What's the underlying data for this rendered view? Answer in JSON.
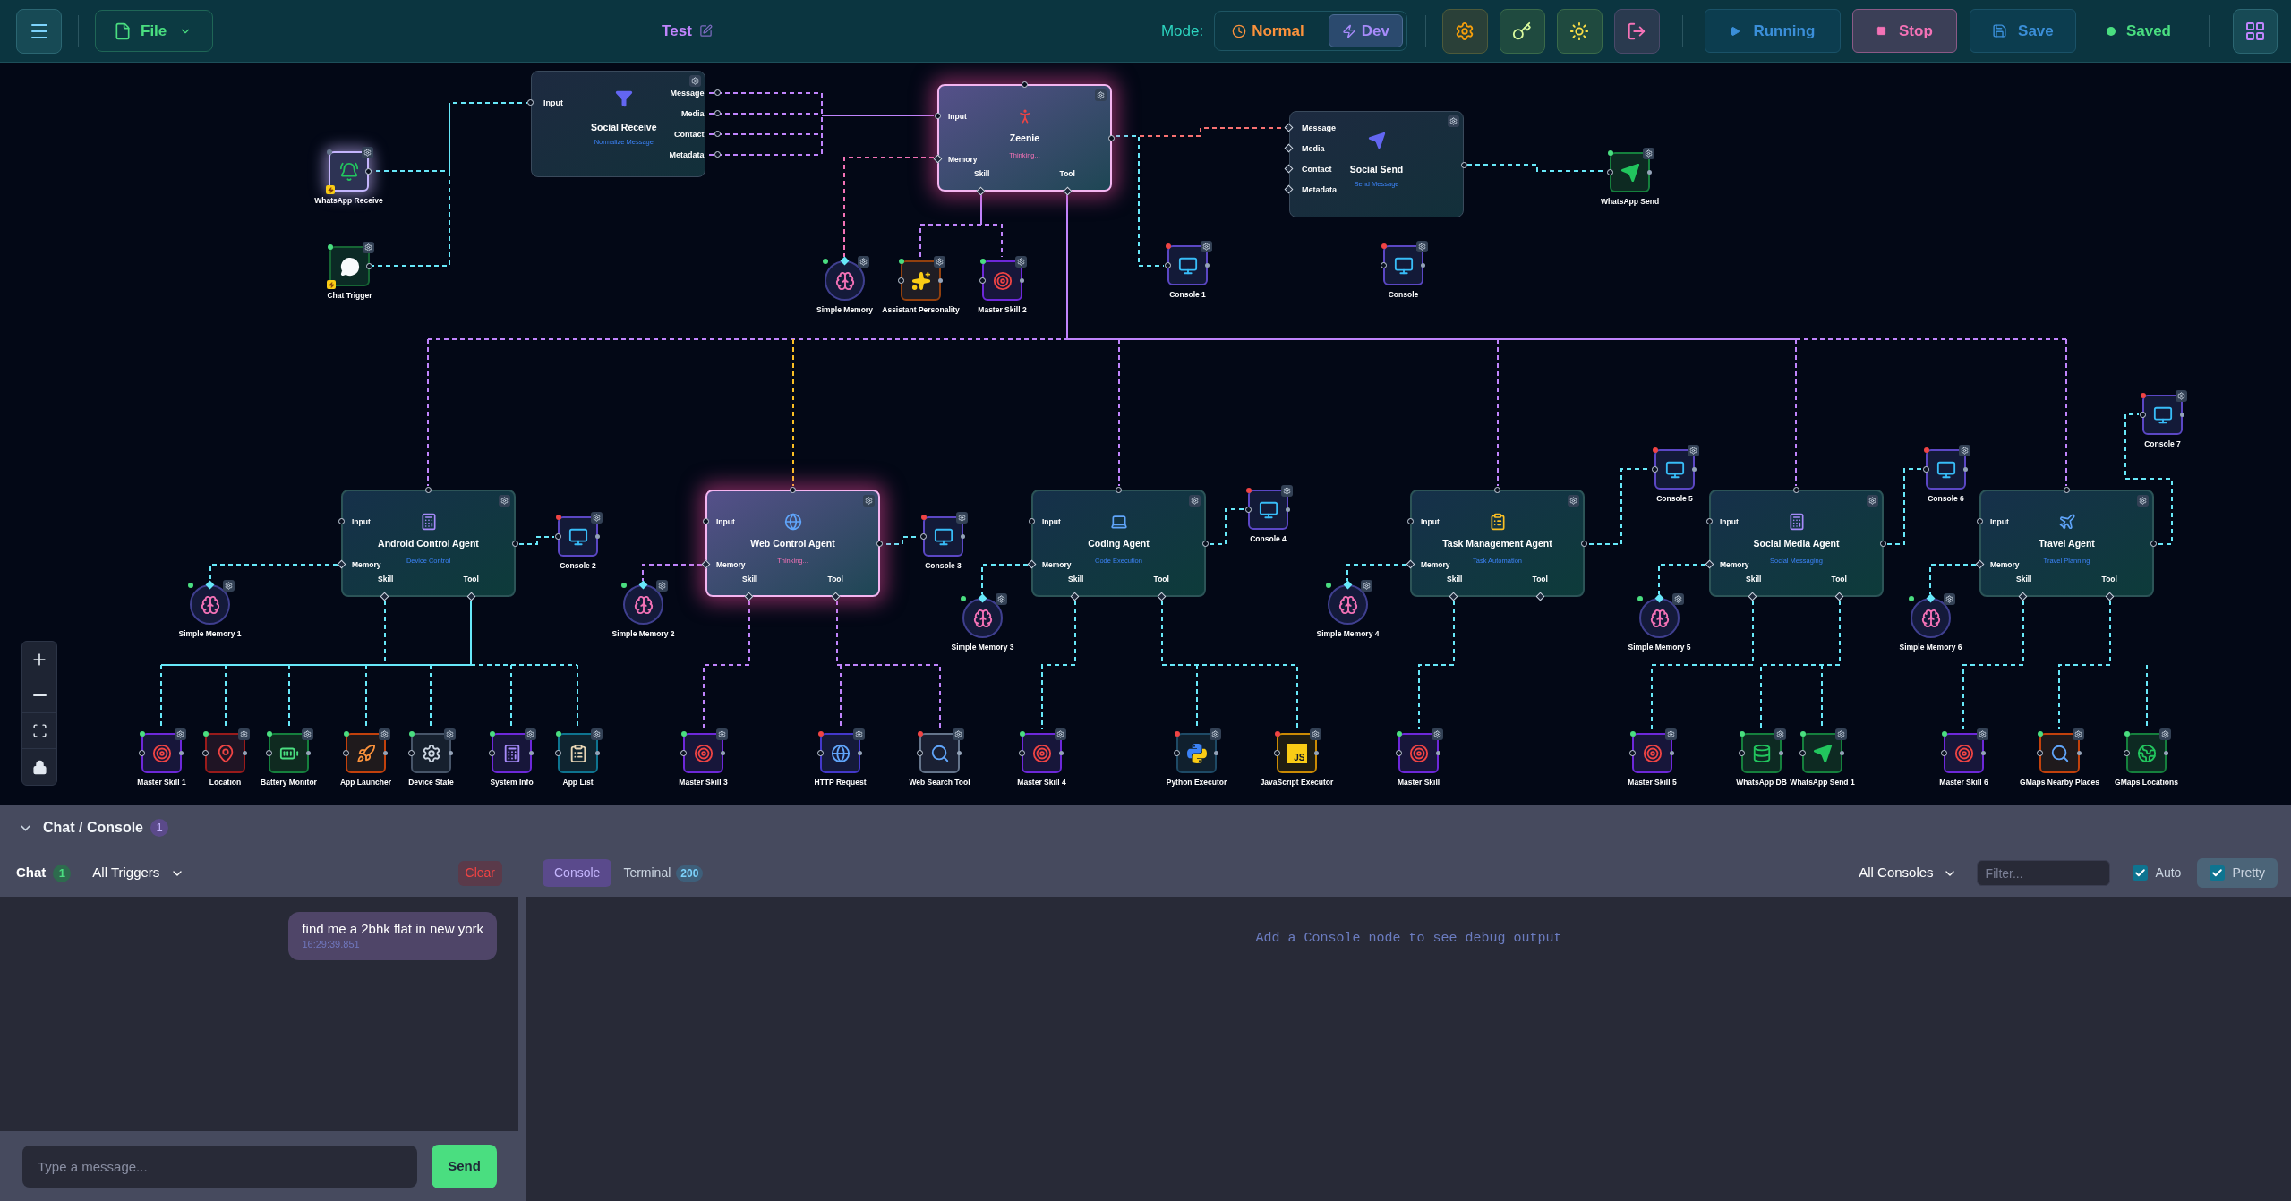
{
  "toolbar": {
    "file": "File",
    "title": "Test",
    "mode_label": "Mode:",
    "modes": [
      {
        "label": "Normal",
        "selected": false
      },
      {
        "label": "Dev",
        "selected": true
      }
    ],
    "run": "Running",
    "stop": "Stop",
    "save": "Save",
    "save_status": "Saved"
  },
  "canvas": {
    "nodes": [
      {
        "kind": "whatsapp-trigger",
        "label": "WhatsApp Receive",
        "active": true,
        "color": "#64748b"
      },
      {
        "kind": "chat-trigger",
        "label": "Chat Trigger",
        "active": false,
        "color": "#4ade80"
      },
      {
        "kind": "social-receive",
        "title": "Social Receive",
        "subtitle": "Normalize Message",
        "active": false,
        "inputs": [
          "Input"
        ],
        "outputs": [
          "Message",
          "Media",
          "Contact",
          "Metadata"
        ]
      },
      {
        "kind": "assistant",
        "title": "Zeenie",
        "subtitle": "Thinking...",
        "active": true,
        "ports": [
          "Input",
          "Memory",
          "Skill",
          "Tool"
        ]
      },
      {
        "kind": "social-send",
        "title": "Social Send",
        "subtitle": "Send Message",
        "active": false,
        "inputs": [
          "Message",
          "Media",
          "Contact",
          "Metadata"
        ]
      },
      {
        "kind": "whatsapp-send",
        "label": "WhatsApp Send",
        "active": false,
        "color": "#4ade80"
      },
      {
        "kind": "memory",
        "label": "Simple Memory",
        "active": false,
        "color": "#4ade80"
      },
      {
        "kind": "personality",
        "label": "Assistant Personality",
        "active": false,
        "color": "#4ade80"
      },
      {
        "kind": "skill",
        "label": "Master Skill 2",
        "active": false,
        "color": "#4ade80"
      },
      {
        "kind": "console",
        "label": "Console 1",
        "active": false,
        "color": "#ef4444"
      },
      {
        "kind": "console",
        "label": "Console",
        "active": false,
        "color": "#ef4444"
      },
      {
        "kind": "android",
        "title": "Android Control Agent",
        "subtitle": "Device Control",
        "active": false,
        "ports": [
          "Input",
          "Memory",
          "Skill",
          "Tool"
        ]
      },
      {
        "kind": "console",
        "label": "Console 2",
        "active": false,
        "color": "#ef4444"
      },
      {
        "kind": "memory",
        "label": "Simple Memory 1",
        "active": false,
        "color": "#4ade80"
      },
      {
        "kind": "web",
        "title": "Web Control Agent",
        "subtitle": "Thinking...",
        "active": true,
        "ports": [
          "Input",
          "Memory",
          "Skill",
          "Tool"
        ]
      },
      {
        "kind": "console",
        "label": "Console 3",
        "active": false,
        "color": "#ef4444"
      },
      {
        "kind": "memory",
        "label": "Simple Memory 2",
        "active": false,
        "color": "#4ade80"
      },
      {
        "kind": "coding",
        "title": "Coding Agent",
        "subtitle": "Code Execution",
        "active": false,
        "ports": [
          "Input",
          "Memory",
          "Skill",
          "Tool"
        ]
      },
      {
        "kind": "console",
        "label": "Console 4",
        "active": false,
        "color": "#ef4444"
      },
      {
        "kind": "memory",
        "label": "Simple Memory 3",
        "active": false,
        "color": "#4ade80"
      },
      {
        "kind": "task",
        "title": "Task Management Agent",
        "subtitle": "Task Automation",
        "active": false,
        "ports": [
          "Input",
          "Memory",
          "Skill",
          "Tool"
        ]
      },
      {
        "kind": "console",
        "label": "Console 5",
        "active": false,
        "color": "#ef4444"
      },
      {
        "kind": "memory",
        "label": "Simple Memory 4",
        "active": false,
        "color": "#4ade80"
      },
      {
        "kind": "social-media",
        "title": "Social Media Agent",
        "subtitle": "Social Messaging",
        "active": false,
        "ports": [
          "Input",
          "Memory",
          "Skill",
          "Tool"
        ]
      },
      {
        "kind": "console",
        "label": "Console 6",
        "active": false,
        "color": "#ef4444"
      },
      {
        "kind": "memory",
        "label": "Simple Memory 5",
        "active": false,
        "color": "#4ade80"
      },
      {
        "kind": "travel",
        "title": "Travel Agent",
        "subtitle": "Travel Planning",
        "active": false,
        "ports": [
          "Input",
          "Memory",
          "Skill",
          "Tool"
        ]
      },
      {
        "kind": "console",
        "label": "Console 7",
        "active": false,
        "color": "#ef4444"
      },
      {
        "kind": "memory",
        "label": "Simple Memory 6",
        "active": false,
        "color": "#4ade80"
      },
      {
        "kind": "skill",
        "label": "Master Skill 1",
        "active": false,
        "color": "#4ade80"
      },
      {
        "kind": "location",
        "label": "Location",
        "active": false,
        "color": "#4ade80"
      },
      {
        "kind": "battery",
        "label": "Battery Monitor",
        "active": false,
        "color": "#4ade80"
      },
      {
        "kind": "launcher",
        "label": "App Launcher",
        "active": false,
        "color": "#4ade80"
      },
      {
        "kind": "device",
        "label": "Device State",
        "active": false,
        "color": "#4ade80"
      },
      {
        "kind": "sysinfo",
        "label": "System Info",
        "active": false,
        "color": "#4ade80"
      },
      {
        "kind": "applist",
        "label": "App List",
        "active": false,
        "color": "#4ade80"
      },
      {
        "kind": "skill",
        "label": "Master Skill 3",
        "active": false,
        "color": "#4ade80"
      },
      {
        "kind": "http",
        "label": "HTTP Request",
        "active": false,
        "color": "#ef4444"
      },
      {
        "kind": "search",
        "label": "Web Search Tool",
        "active": false,
        "color": "#ef4444"
      },
      {
        "kind": "skill",
        "label": "Master Skill 4",
        "active": false,
        "color": "#4ade80"
      },
      {
        "kind": "python",
        "label": "Python Executor",
        "active": false,
        "color": "#ef4444"
      },
      {
        "kind": "javascript",
        "label": "JavaScript Executor",
        "active": false,
        "color": "#ef4444",
        "icon_text": "JS"
      },
      {
        "kind": "skill",
        "label": "Master Skill",
        "active": false,
        "color": "#4ade80"
      },
      {
        "kind": "skill",
        "label": "Master Skill 5",
        "active": false,
        "color": "#4ade80"
      },
      {
        "kind": "database",
        "label": "WhatsApp DB",
        "active": false,
        "color": "#4ade80"
      },
      {
        "kind": "whatsapp-send",
        "label": "WhatsApp Send 1",
        "active": false,
        "color": "#4ade80"
      },
      {
        "kind": "skill",
        "label": "Master Skill 6",
        "active": false,
        "color": "#4ade80"
      },
      {
        "kind": "map-search",
        "label": "GMaps Nearby Places",
        "active": false,
        "color": "#4ade80"
      },
      {
        "kind": "globe",
        "label": "GMaps Locations",
        "active": false,
        "color": "#4ade80"
      }
    ]
  },
  "panel": {
    "title": "Chat / Console",
    "count": "1",
    "expanded": true,
    "chat": {
      "label": "Chat",
      "count": "1",
      "filter": "All Triggers",
      "clear": "Clear",
      "messages": [
        {
          "text": "find me a 2bhk flat in new york",
          "time": "16:29:39.851"
        }
      ],
      "input": {
        "placeholder": "Type a message..."
      },
      "send": "Send"
    },
    "console": {
      "tabs": [
        {
          "label": "Console",
          "selected": true
        },
        {
          "label": "Terminal",
          "count": "200",
          "selected": false
        }
      ],
      "source": "All Consoles",
      "filter": {
        "placeholder": "Filter..."
      },
      "options": [
        {
          "kind": "plain",
          "label": "Auto",
          "checked": true
        },
        {
          "kind": "button",
          "label": "Pretty",
          "checked": true
        }
      ],
      "empty": "Add a Console node to see debug output"
    }
  }
}
